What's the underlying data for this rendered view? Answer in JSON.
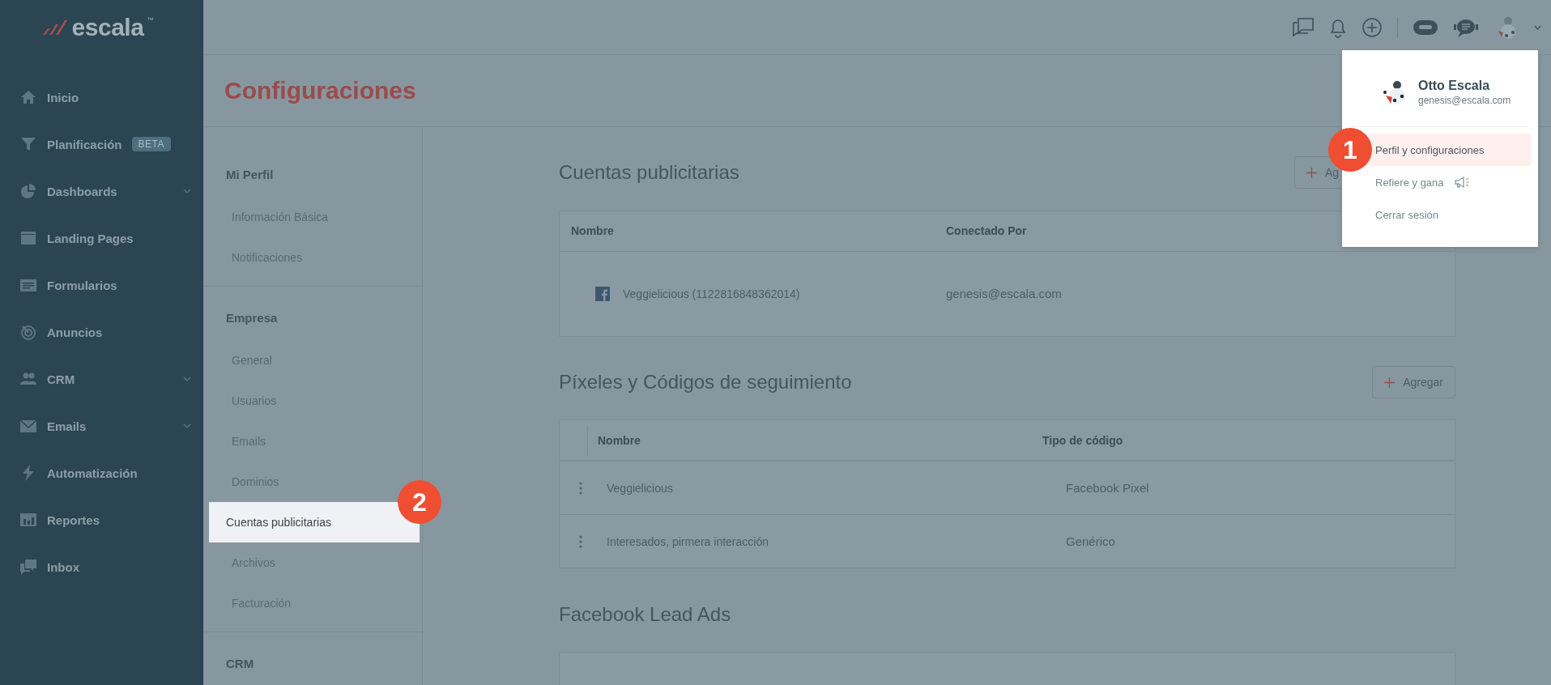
{
  "sidebar": {
    "logo": "escala",
    "logo_mark": "™",
    "items": [
      {
        "label": "Inicio",
        "expandable": false
      },
      {
        "label": "Planificación",
        "badge": "BETA",
        "expandable": false
      },
      {
        "label": "Dashboards",
        "expandable": true
      },
      {
        "label": "Landing Pages",
        "expandable": false
      },
      {
        "label": "Formularios",
        "expandable": false
      },
      {
        "label": "Anuncios",
        "expandable": false
      },
      {
        "label": "CRM",
        "expandable": true
      },
      {
        "label": "Emails",
        "expandable": true
      },
      {
        "label": "Automatización",
        "expandable": false
      },
      {
        "label": "Reportes",
        "expandable": false
      },
      {
        "label": "Inbox",
        "expandable": false
      }
    ]
  },
  "page_title": "Configuraciones",
  "settings_nav": [
    {
      "heading": "Mi Perfil",
      "items": [
        {
          "label": "Información Básica",
          "selected": false
        },
        {
          "label": "Notificaciones",
          "selected": false
        }
      ]
    },
    {
      "heading": "Empresa",
      "items": [
        {
          "label": "General",
          "selected": false
        },
        {
          "label": "Usuarios",
          "selected": false
        },
        {
          "label": "Emails",
          "selected": false
        },
        {
          "label": "Dominios",
          "selected": false
        },
        {
          "label": "Cuentas publicitarias",
          "selected": true,
          "step": "2"
        },
        {
          "label": "Archivos",
          "selected": false
        },
        {
          "label": "Facturación",
          "selected": false
        }
      ]
    },
    {
      "heading": "CRM"
    }
  ],
  "ad_accounts": {
    "title": "Cuentas publicitarias",
    "button": "Ag",
    "columns": [
      "Nombre",
      "Conectado Por"
    ],
    "rows": [
      {
        "name": "Veggielicious (1122816848362014)",
        "connected_by": "genesis@escala.com"
      }
    ]
  },
  "pixels": {
    "title": "Píxeles y Códigos de seguimiento",
    "button": "Agregar",
    "columns": [
      "Nombre",
      "Tipo de código"
    ],
    "rows": [
      {
        "name": "Veggielicious",
        "type": "Facebook Pixel"
      },
      {
        "name": "Interesados, pirmera interacción",
        "type": "Genérico"
      }
    ]
  },
  "lead_ads": {
    "title": "Facebook Lead Ads"
  },
  "user_menu": {
    "name": "Otto Escala",
    "email": "genesis@escala.com",
    "items": [
      {
        "label": "Perfil y configuraciones",
        "selected": true,
        "step": "1",
        "kind": "plain"
      },
      {
        "label": "Refiere y gana",
        "selected": false,
        "kind": "megaphone"
      },
      {
        "label": "Cerrar sesión",
        "selected": false,
        "kind": "plain"
      }
    ]
  }
}
